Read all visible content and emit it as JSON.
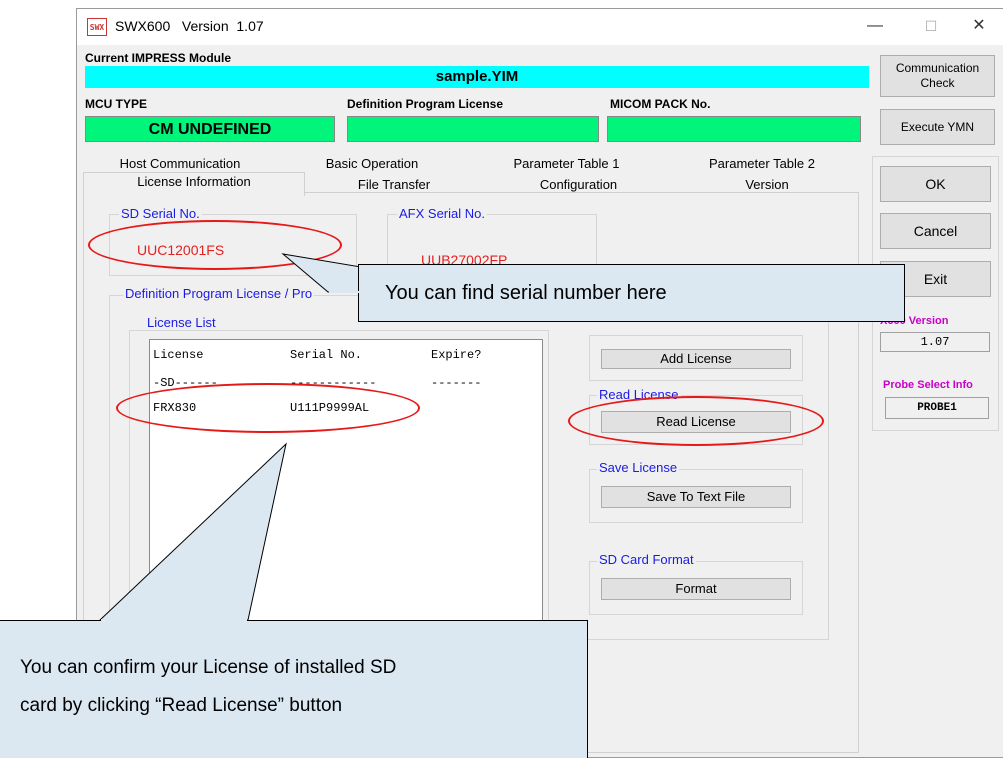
{
  "window": {
    "icon_text": "SWX",
    "title": "SWX600   Version  1.07",
    "controls": {
      "minimize": "—",
      "maximize": "☐",
      "close": "✕"
    }
  },
  "module": {
    "label": "Current IMPRESS Module",
    "file": "sample.YIM"
  },
  "mcu": {
    "label": "MCU TYPE",
    "value": "CM UNDEFINED",
    "license_label": "Definition Program License",
    "license_value": "",
    "micom_label": "MICOM PACK No.",
    "micom_value": ""
  },
  "right_buttons": {
    "comm_check": "Communication Check",
    "execute_ymn": "Execute YMN",
    "ok": "OK",
    "cancel": "Cancel",
    "exit": "Exit"
  },
  "version_box": {
    "label": "X600 Version",
    "value": "1.07"
  },
  "probe_box": {
    "label": "Probe Select Info",
    "value": "PROBE1"
  },
  "tabs_row1": [
    "Host Communication",
    "Basic Operation",
    "Parameter Table 1",
    "Parameter Table 2"
  ],
  "tabs_row2": [
    "License Information",
    "File Transfer",
    "Configuration",
    "Version"
  ],
  "sd_serial": {
    "label": "SD Serial No.",
    "value": "UUC12001FS"
  },
  "afx_serial": {
    "label": "AFX Serial No.",
    "value": "UUB27002FP"
  },
  "def_license_group": "Definition Program License / Pro",
  "license_list": {
    "label": "License List",
    "headers": [
      "License",
      "Serial No.",
      "Expire?"
    ],
    "rows": [
      [
        "-SD------",
        "------------",
        "-------"
      ],
      [
        "FRX830",
        "U111P9999AL",
        ""
      ]
    ]
  },
  "groups": {
    "add_license_btn": "Add License",
    "read_license_label": "Read License",
    "read_license_btn": "Read License",
    "save_license_label": "Save License",
    "save_btn": "Save To Text File",
    "sd_format_label": "SD Card Format",
    "format_btn": "Format"
  },
  "callouts": {
    "serial": "You can find serial number here",
    "license_line1": "You can confirm your License of installed SD",
    "license_line2": "card by clicking “Read License” button"
  },
  "colors": {
    "cyan": "#00ffff",
    "green": "#00f57a",
    "red_text": "#e62020",
    "blue_label": "#1a1ae6",
    "magenta_label": "#c800c8",
    "callout_fill": "#dbe8f2",
    "oval_red": "#e61919"
  }
}
